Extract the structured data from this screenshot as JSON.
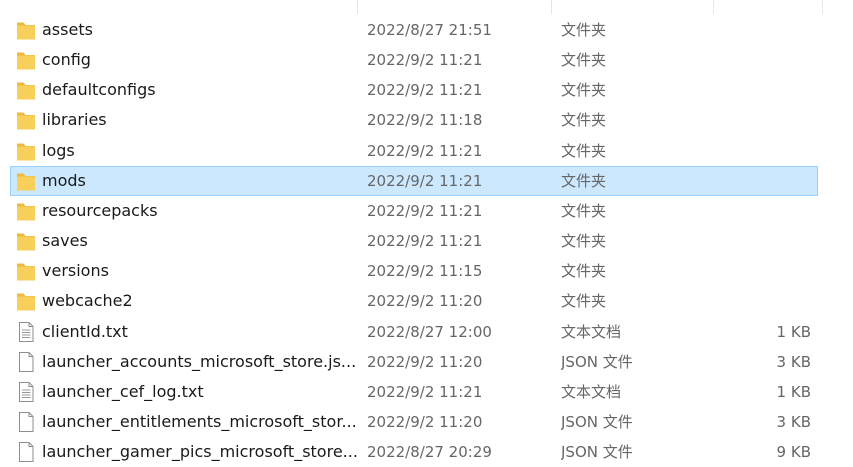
{
  "colors": {
    "folder_body": "#F8CF5B",
    "folder_tab": "#EEB93C",
    "selection_bg": "#CCE8FF",
    "selection_border": "#99D1FF",
    "meta_text": "#666666"
  },
  "files": [
    {
      "name": "assets",
      "date": "2022/8/27 21:51",
      "type": "文件夹",
      "size": "",
      "icon": "folder-icon",
      "selected": false
    },
    {
      "name": "config",
      "date": "2022/9/2 11:21",
      "type": "文件夹",
      "size": "",
      "icon": "folder-icon",
      "selected": false
    },
    {
      "name": "defaultconfigs",
      "date": "2022/9/2 11:21",
      "type": "文件夹",
      "size": "",
      "icon": "folder-icon",
      "selected": false
    },
    {
      "name": "libraries",
      "date": "2022/9/2 11:18",
      "type": "文件夹",
      "size": "",
      "icon": "folder-icon",
      "selected": false
    },
    {
      "name": "logs",
      "date": "2022/9/2 11:21",
      "type": "文件夹",
      "size": "",
      "icon": "folder-icon",
      "selected": false
    },
    {
      "name": "mods",
      "date": "2022/9/2 11:21",
      "type": "文件夹",
      "size": "",
      "icon": "folder-icon",
      "selected": true
    },
    {
      "name": "resourcepacks",
      "date": "2022/9/2 11:21",
      "type": "文件夹",
      "size": "",
      "icon": "folder-icon",
      "selected": false
    },
    {
      "name": "saves",
      "date": "2022/9/2 11:21",
      "type": "文件夹",
      "size": "",
      "icon": "folder-icon",
      "selected": false
    },
    {
      "name": "versions",
      "date": "2022/9/2 11:15",
      "type": "文件夹",
      "size": "",
      "icon": "folder-icon",
      "selected": false
    },
    {
      "name": "webcache2",
      "date": "2022/9/2 11:20",
      "type": "文件夹",
      "size": "",
      "icon": "folder-icon",
      "selected": false
    },
    {
      "name": "clientId.txt",
      "date": "2022/8/27 12:00",
      "type": "文本文档",
      "size": "1 KB",
      "icon": "text-file-icon",
      "selected": false
    },
    {
      "name": "launcher_accounts_microsoft_store.js...",
      "date": "2022/9/2 11:20",
      "type": "JSON 文件",
      "size": "3 KB",
      "icon": "file-icon",
      "selected": false
    },
    {
      "name": "launcher_cef_log.txt",
      "date": "2022/9/2 11:21",
      "type": "文本文档",
      "size": "1 KB",
      "icon": "text-file-icon",
      "selected": false
    },
    {
      "name": "launcher_entitlements_microsoft_stor...",
      "date": "2022/9/2 11:20",
      "type": "JSON 文件",
      "size": "3 KB",
      "icon": "file-icon",
      "selected": false
    },
    {
      "name": "launcher_gamer_pics_microsoft_store...",
      "date": "2022/8/27 20:29",
      "type": "JSON 文件",
      "size": "9 KB",
      "icon": "file-icon",
      "selected": false
    }
  ]
}
